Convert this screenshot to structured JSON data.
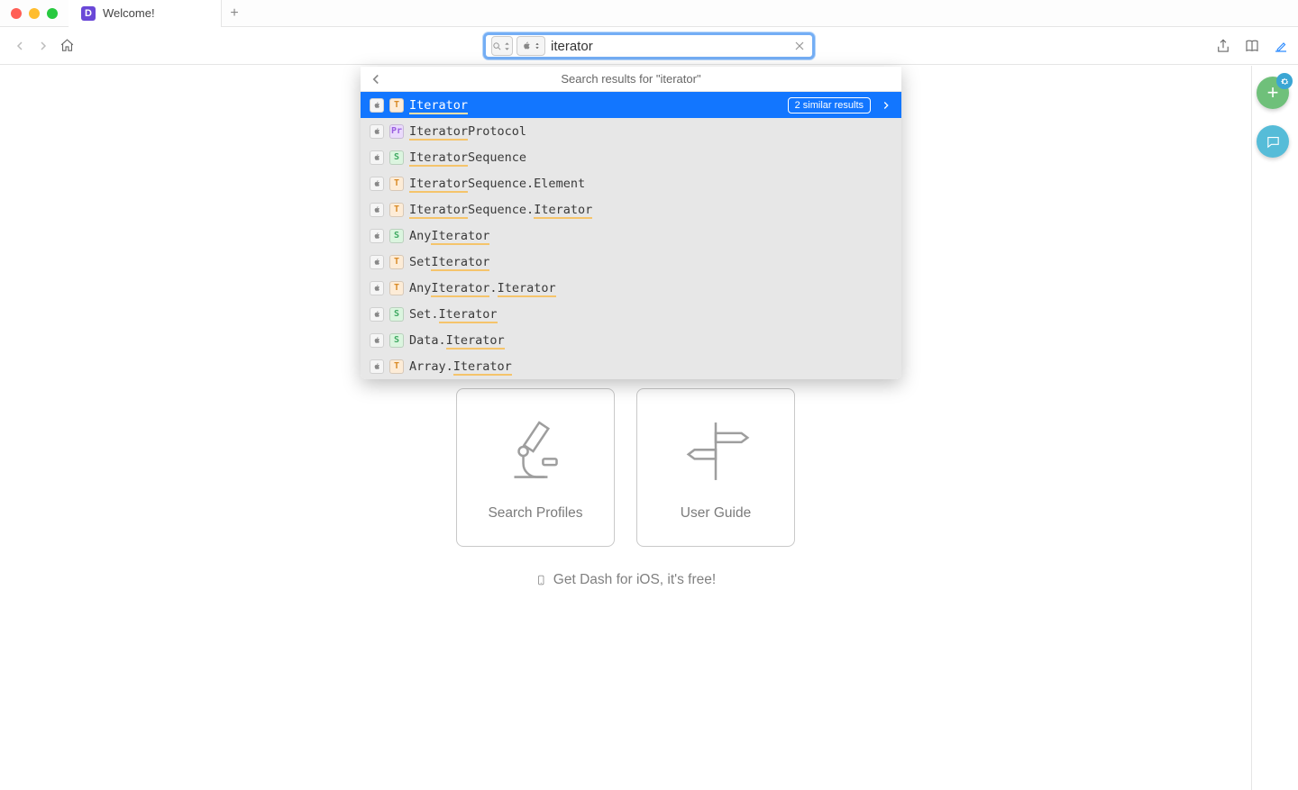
{
  "titlebar": {
    "tab_title": "Welcome!",
    "app_initial": "D"
  },
  "search": {
    "query": "iterator"
  },
  "dropdown": {
    "header_prefix": "Search results for \"",
    "header_query": "iterator",
    "header_suffix": "\"",
    "similar": "2 similar results",
    "rows": [
      {
        "kind": "T",
        "segs": [
          [
            "Iterator",
            1
          ]
        ]
      },
      {
        "kind": "Pr",
        "segs": [
          [
            "Iterator",
            1
          ],
          [
            "Protocol",
            0
          ]
        ]
      },
      {
        "kind": "S",
        "segs": [
          [
            "Iterator",
            1
          ],
          [
            "Sequence",
            0
          ]
        ]
      },
      {
        "kind": "T",
        "segs": [
          [
            "Iterator",
            1
          ],
          [
            "Sequence.Element",
            0
          ]
        ]
      },
      {
        "kind": "T",
        "segs": [
          [
            "Iterator",
            1
          ],
          [
            "Sequence.",
            0
          ],
          [
            "Iterator",
            1
          ]
        ]
      },
      {
        "kind": "S",
        "segs": [
          [
            "Any",
            0
          ],
          [
            "Iterator",
            1
          ]
        ]
      },
      {
        "kind": "T",
        "segs": [
          [
            "Set",
            0
          ],
          [
            "Iterator",
            1
          ]
        ]
      },
      {
        "kind": "T",
        "segs": [
          [
            "Any",
            0
          ],
          [
            "Iterator",
            1
          ],
          [
            ".",
            0
          ],
          [
            "Iterator",
            1
          ]
        ]
      },
      {
        "kind": "S",
        "segs": [
          [
            "Set.",
            0
          ],
          [
            "Iterator",
            1
          ]
        ]
      },
      {
        "kind": "S",
        "segs": [
          [
            "Data.",
            0
          ],
          [
            "Iterator",
            1
          ]
        ]
      },
      {
        "kind": "T",
        "segs": [
          [
            "Array.",
            0
          ],
          [
            "Iterator",
            1
          ]
        ]
      }
    ]
  },
  "cards": {
    "profiles": "Search Profiles",
    "guide": "User Guide"
  },
  "ios_link": "Get Dash for iOS, it's free!"
}
